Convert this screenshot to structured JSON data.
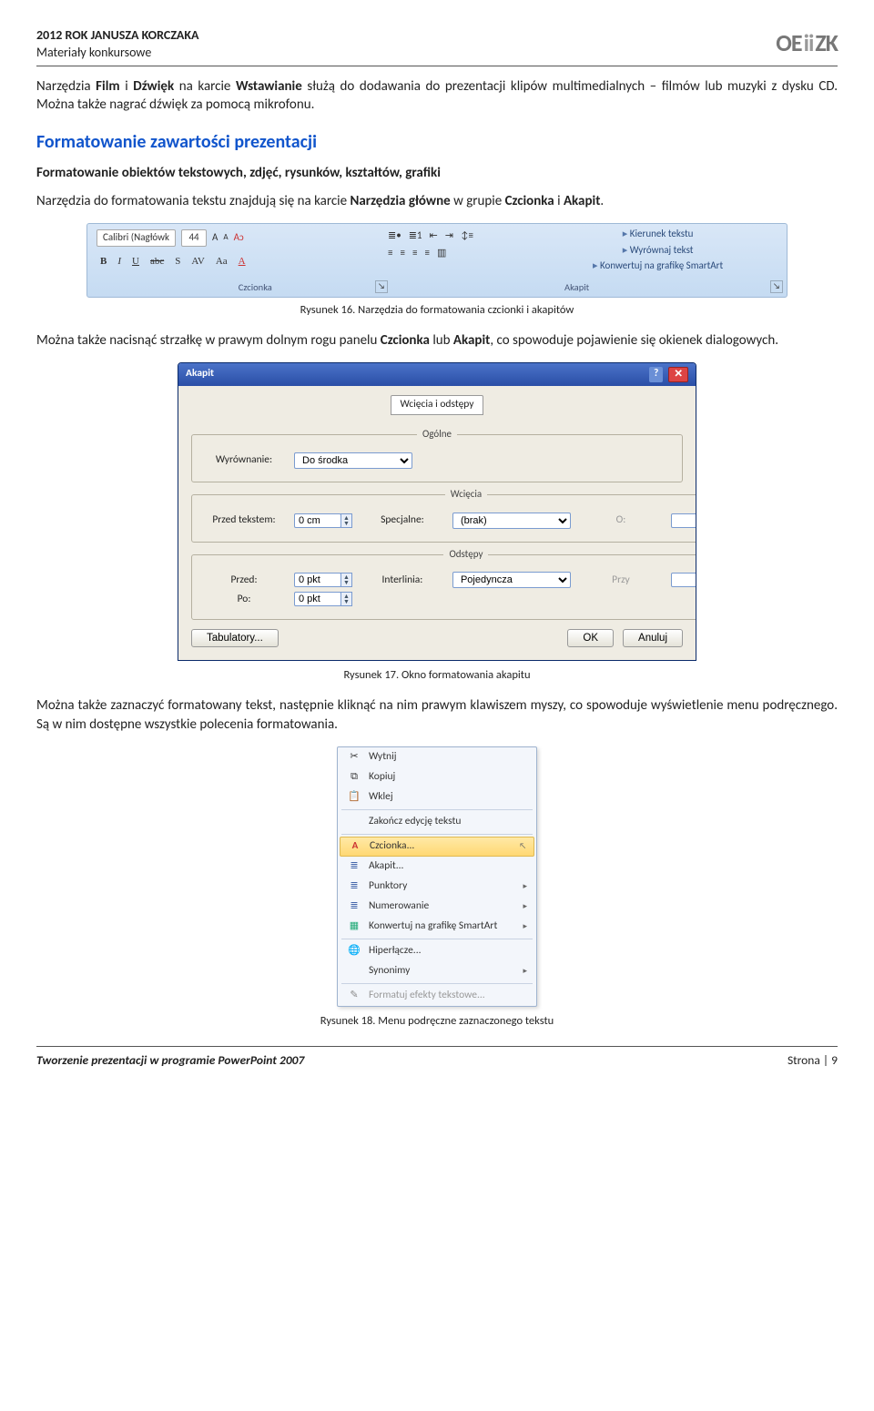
{
  "header": {
    "title": "2012 ROK JANUSZA KORCZAKA",
    "subtitle": "Materiały konkursowe",
    "logo": "OEiiZK"
  },
  "para1_a": "Narzędzia ",
  "para1_b": "Film",
  "para1_c": " i ",
  "para1_d": "Dźwięk",
  "para1_e": " na karcie ",
  "para1_f": "Wstawianie",
  "para1_g": " służą do dodawania do prezentacji klipów multimedialnych – filmów lub muzyki z dysku CD. Można także nagrać dźwięk za pomocą mikrofonu.",
  "h2": "Formatowanie zawartości prezentacji",
  "sub": "Formatowanie obiektów tekstowych, zdjęć, rysunków, kształtów, grafiki",
  "para2_a": "Narzędzia do formatowania tekstu znajdują się na karcie ",
  "para2_b": "Narzędzia główne",
  "para2_c": " w grupie ",
  "para2_d": "Czcionka",
  "para2_e": " i ",
  "para2_f": "Akapit",
  "para2_g": ".",
  "ribbon": {
    "fontname": "Calibri (Nagłówk",
    "fontsize": "44",
    "dir1": "Kierunek tekstu",
    "dir2": "Wyrównaj tekst",
    "dir3": "Konwertuj na grafikę SmartArt",
    "group1": "Czcionka",
    "group2": "Akapit"
  },
  "fig16": "Rysunek 16. Narzędzia do formatowania czcionki i akapitów",
  "para3_a": "Można także nacisnąć strzałkę w prawym dolnym rogu panelu ",
  "para3_b": "Czcionka",
  "para3_c": " lub ",
  "para3_d": "Akapit",
  "para3_e": ", co spowoduje pojawienie się okienek dialogowych.",
  "dialog": {
    "title": "Akapit",
    "tab": "Wcięcia i odstępy",
    "g_ogolne": "Ogólne",
    "l_wyrownanie": "Wyrównanie:",
    "v_wyrownanie": "Do środka",
    "g_wciecia": "Wcięcia",
    "l_przed_tekstem": "Przed tekstem:",
    "v_przed_tekstem": "0 cm",
    "l_specjalne": "Specjalne:",
    "v_specjalne": "(brak)",
    "l_o": "O:",
    "g_odstepy": "Odstępy",
    "l_przed": "Przed:",
    "v_przed": "0 pkt",
    "l_interlinia": "Interlinia:",
    "v_interlinia": "Pojedyncza",
    "l_przy": "Przy",
    "l_po": "Po:",
    "v_po": "0 pkt",
    "btn_tab": "Tabulatory...",
    "btn_ok": "OK",
    "btn_cancel": "Anuluj"
  },
  "fig17": "Rysunek 17. Okno formatowania akapitu",
  "para4": "Można także zaznaczyć formatowany tekst, następnie kliknąć na nim prawym klawiszem myszy, co spowoduje wyświetlenie menu podręcznego. Są w nim dostępne wszystkie polecenia formatowania.",
  "ctx": {
    "i1": "Wytnij",
    "i2": "Kopiuj",
    "i3": "Wklej",
    "i4": "Zakończ edycję tekstu",
    "i5": "Czcionka...",
    "i6": "Akapit...",
    "i7": "Punktory",
    "i8": "Numerowanie",
    "i9": "Konwertuj na grafikę SmartArt",
    "i10": "Hiperłącze...",
    "i11": "Synonimy",
    "i12": "Formatuj efekty tekstowe..."
  },
  "fig18": "Rysunek 18. Menu podręczne zaznaczonego tekstu",
  "footer": {
    "left": "Tworzenie prezentacji w programie PowerPoint 2007",
    "right": "Strona | 9"
  }
}
